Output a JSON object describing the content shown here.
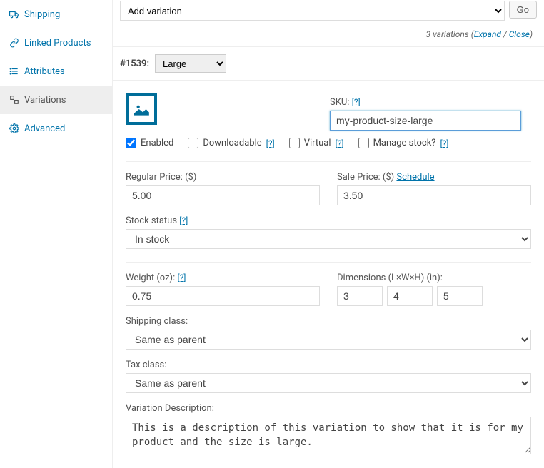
{
  "sidebar": {
    "items": [
      {
        "label": "Shipping",
        "icon": "truck"
      },
      {
        "label": "Linked Products",
        "icon": "link"
      },
      {
        "label": "Attributes",
        "icon": "list"
      },
      {
        "label": "Variations",
        "icon": "variations",
        "active": true
      },
      {
        "label": "Advanced",
        "icon": "gear"
      }
    ]
  },
  "toolbar": {
    "add_variation_label": "Add variation",
    "go_label": "Go"
  },
  "summary": {
    "count_text": "3 variations",
    "open": "(",
    "expand": "Expand",
    "sep": " / ",
    "close_link": "Close",
    "close_paren": ")"
  },
  "variation": {
    "hash": "#1539:",
    "size_selected": "Large"
  },
  "sku": {
    "label": "SKU:",
    "help": "[?]",
    "value": "my-product-size-large"
  },
  "checks": {
    "enabled": "Enabled",
    "downloadable": "Downloadable",
    "virtual": "Virtual",
    "manage_stock": "Manage stock?",
    "help": "[?]"
  },
  "prices": {
    "regular_label": "Regular Price: ($)",
    "regular_value": "5.00",
    "sale_label": "Sale Price: ($) ",
    "schedule": "Schedule",
    "sale_value": "3.50"
  },
  "stock": {
    "label": "Stock status",
    "help": "[?]",
    "value": "In stock"
  },
  "weight": {
    "label": "Weight (oz): ",
    "help": "[?]",
    "value": "0.75"
  },
  "dimensions": {
    "label": "Dimensions (L×W×H) (in):",
    "l": "3",
    "w": "4",
    "h": "5"
  },
  "shipping_class": {
    "label": "Shipping class:",
    "value": "Same as parent"
  },
  "tax_class": {
    "label": "Tax class:",
    "value": "Same as parent"
  },
  "description": {
    "label": "Variation Description:",
    "value": "This is a description of this variation to show that it is for my product and the size is large."
  }
}
